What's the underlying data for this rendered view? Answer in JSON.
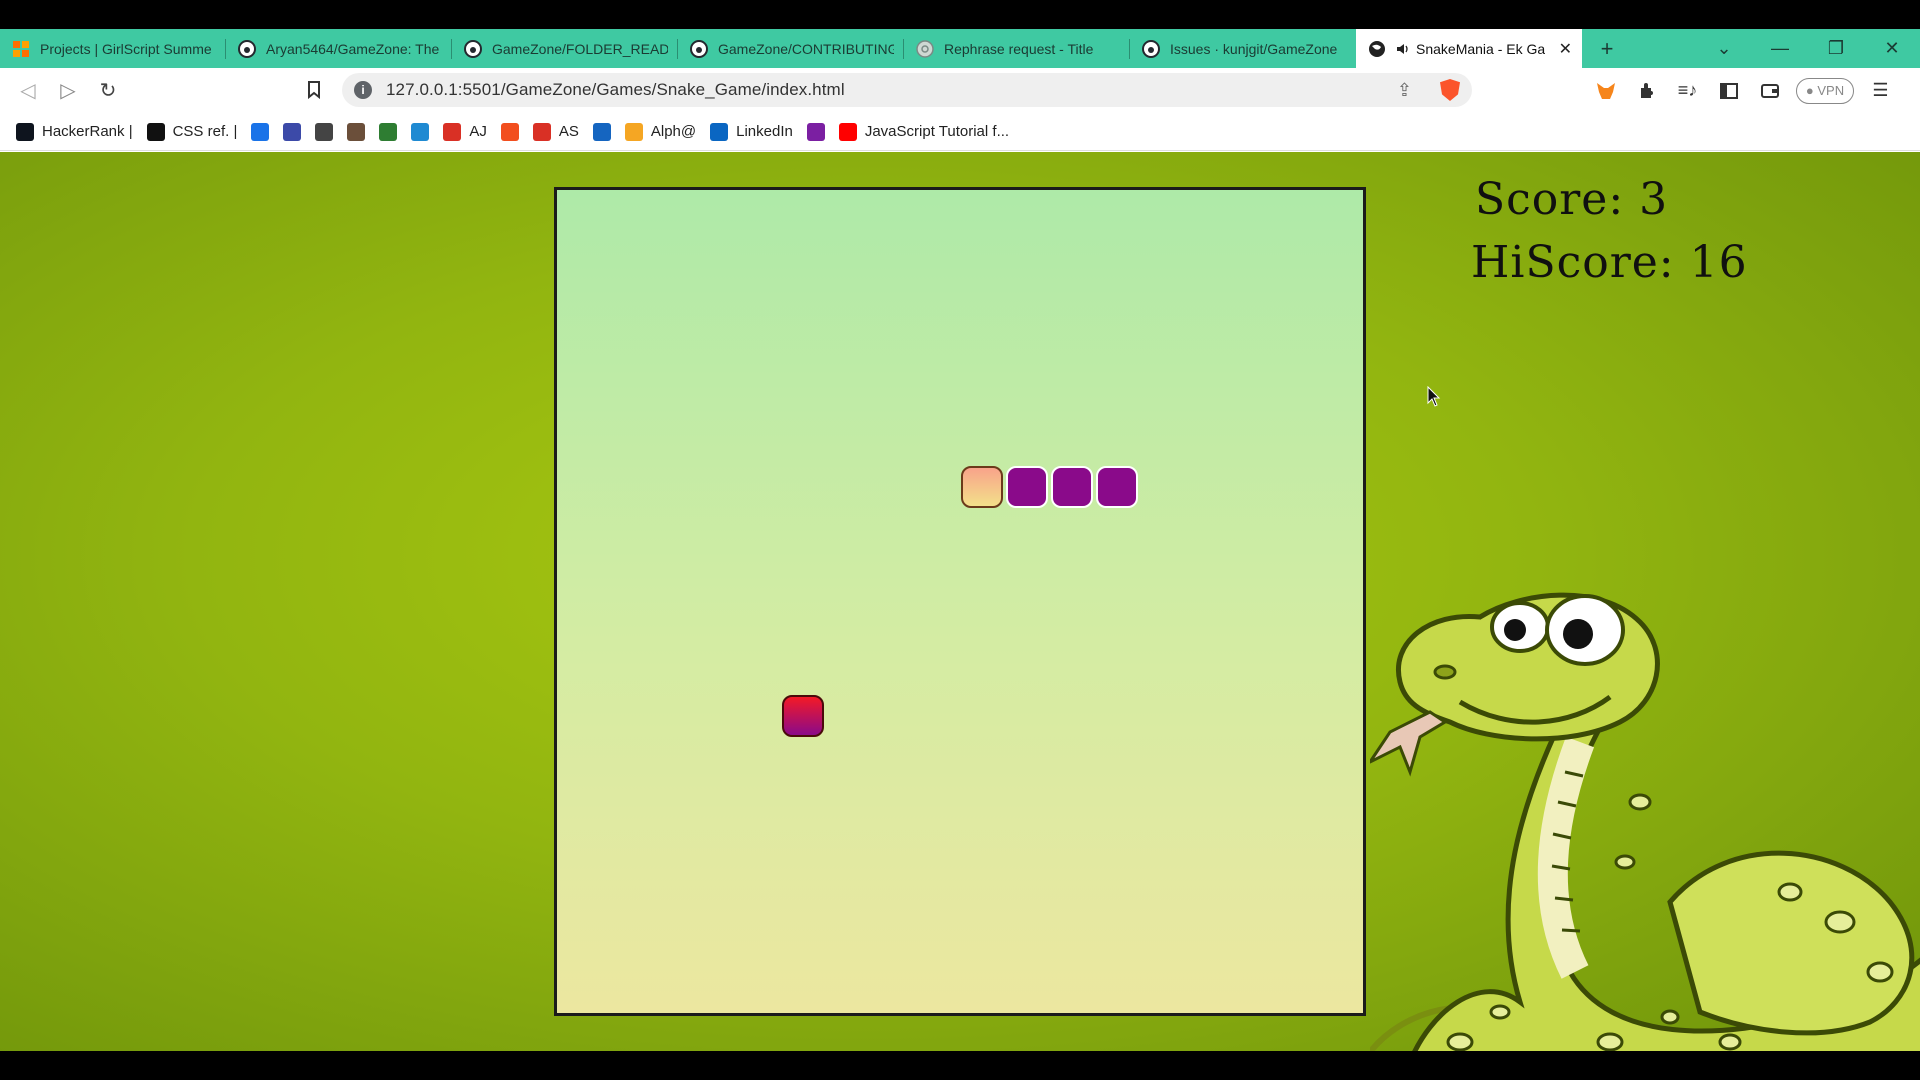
{
  "browser": {
    "tabs": [
      {
        "title": "Projects | GirlScript Summe",
        "icon": "girlscript-icon",
        "active": false
      },
      {
        "title": "Aryan5464/GameZone: The",
        "icon": "github-icon",
        "active": false
      },
      {
        "title": "GameZone/FOLDER_READM",
        "icon": "github-icon",
        "active": false
      },
      {
        "title": "GameZone/CONTRIBUTING",
        "icon": "github-icon",
        "active": false
      },
      {
        "title": "Rephrase request - Title",
        "icon": "chat-icon",
        "active": false
      },
      {
        "title": "Issues · kunjgit/GameZone",
        "icon": "github-icon",
        "active": false
      },
      {
        "title": "SnakeMania - Ek Ga",
        "icon": "globe-icon",
        "active": true,
        "audio": true
      }
    ],
    "new_tab_symbol": "+",
    "url": "127.0.0.1:5501/GameZone/Games/Snake_Game/index.html",
    "vpn_label": "VPN",
    "bookmarks": [
      {
        "label": "HackerRank |",
        "icon": "hackerrank-icon",
        "color": "#0e141e"
      },
      {
        "label": "CSS ref. |",
        "icon": "css-ref-icon",
        "color": "#111111"
      },
      {
        "label": "",
        "icon": "docs-icon",
        "color": "#1a73e8"
      },
      {
        "label": "",
        "icon": "un-icon",
        "color": "#3c4aa8"
      },
      {
        "label": "",
        "icon": "leaf-icon",
        "color": "#444444"
      },
      {
        "label": "",
        "icon": "cc-icon",
        "color": "#6b4f3a"
      },
      {
        "label": "",
        "icon": "infinity-icon",
        "color": "#2e7d32"
      },
      {
        "label": "",
        "icon": "edge-icon",
        "color": "#1f8ad2"
      },
      {
        "label": "AJ",
        "icon": "gmail-icon",
        "color": "#d93025"
      },
      {
        "label": "",
        "icon": "figma-icon",
        "color": "#f24e1e"
      },
      {
        "label": "AS",
        "icon": "gmail-icon",
        "color": "#d93025"
      },
      {
        "label": "",
        "icon": "c-icon",
        "color": "#1565c0"
      },
      {
        "label": "Alph@",
        "icon": "alpha-icon",
        "color": "#f5a623"
      },
      {
        "label": "LinkedIn",
        "icon": "linkedin-icon",
        "color": "#0a66c2"
      },
      {
        "label": "",
        "icon": "m-icon",
        "color": "#7b1fa2"
      },
      {
        "label": "JavaScript Tutorial f...",
        "icon": "youtube-icon",
        "color": "#ff0000"
      }
    ]
  },
  "game": {
    "score_text": "Score: 3",
    "hiscore_text": "HiScore: 16",
    "grid_size": 18,
    "snake": [
      {
        "x": 10,
        "y": 7,
        "part": "head"
      },
      {
        "x": 11,
        "y": 7,
        "part": "body"
      },
      {
        "x": 12,
        "y": 7,
        "part": "body"
      },
      {
        "x": 13,
        "y": 7,
        "part": "body"
      }
    ],
    "food": {
      "x": 6,
      "y": 12
    },
    "colors": {
      "head": "#f8a38a",
      "body": "#8a0a8a",
      "food": "#f31a26",
      "page_bg": "#92b510"
    }
  }
}
